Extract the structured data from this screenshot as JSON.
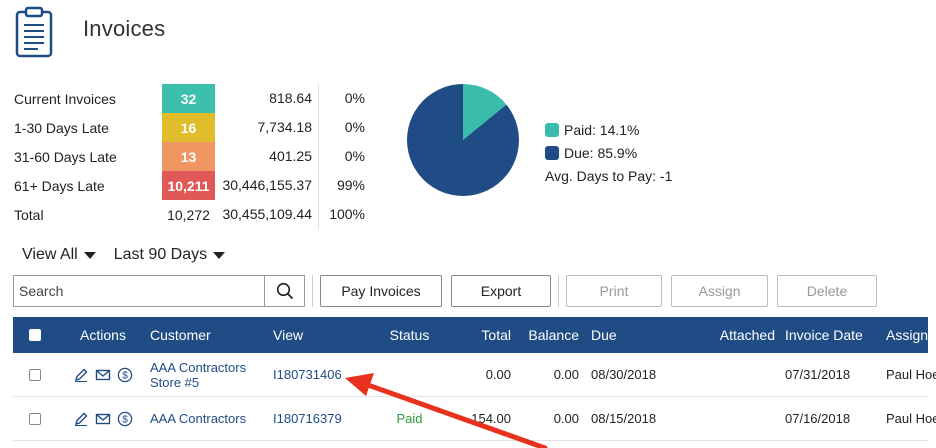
{
  "page": {
    "title": "Invoices"
  },
  "summary": {
    "rows": [
      {
        "label": "Current Invoices",
        "count": "32",
        "amount": "818.64",
        "pct": "0%",
        "color": "#3dbfad"
      },
      {
        "label": "1-30 Days Late",
        "count": "16",
        "amount": "7,734.18",
        "pct": "0%",
        "color": "#dfbd2b"
      },
      {
        "label": "31-60 Days Late",
        "count": "13",
        "amount": "401.25",
        "pct": "0%",
        "color": "#ef9663"
      },
      {
        "label": "61+ Days Late",
        "count": "10,211",
        "amount": "30,446,155.37",
        "pct": "99%",
        "color": "#e05857"
      },
      {
        "label": "Total",
        "count": "10,272",
        "amount": "30,455,109.44",
        "pct": "100%",
        "color": ""
      }
    ]
  },
  "chart_data": {
    "type": "pie",
    "slices": [
      {
        "name": "Paid",
        "value": 14.1,
        "color": "#39bcab"
      },
      {
        "name": "Due",
        "value": 85.9,
        "color": "#1f4c85"
      }
    ]
  },
  "legend": {
    "paid": "Paid: 14.1%",
    "due": "Due: 85.9%",
    "avg_days": "Avg. Days to Pay: -1"
  },
  "filters": {
    "view": "View All",
    "range": "Last 90 Days"
  },
  "toolbar": {
    "search_placeholder": "Search",
    "pay": "Pay Invoices",
    "export": "Export",
    "print": "Print",
    "assign": "Assign",
    "delete": "Delete"
  },
  "grid": {
    "columns": {
      "actions": "Actions",
      "customer": "Customer",
      "view": "View",
      "status": "Status",
      "total": "Total",
      "balance": "Balance",
      "due": "Due",
      "attached": "Attached",
      "invoice_date": "Invoice Date",
      "assigned": "Assigned"
    },
    "rows": [
      {
        "customer": "AAA Contractors Store #5",
        "view": "I180731406",
        "status": "",
        "total": "0.00",
        "balance": "0.00",
        "due": "08/30/2018",
        "attached": "",
        "invoice_date": "07/31/2018",
        "assigned": "Paul Hoeper"
      },
      {
        "customer": "AAA Contractors",
        "view": "I180716379",
        "status": "Paid",
        "total": "154.00",
        "balance": "0.00",
        "due": "08/15/2018",
        "attached": "",
        "invoice_date": "07/16/2018",
        "assigned": "Paul Hoeper"
      }
    ]
  },
  "annotation": {
    "arrow_color": "#e8321e"
  }
}
